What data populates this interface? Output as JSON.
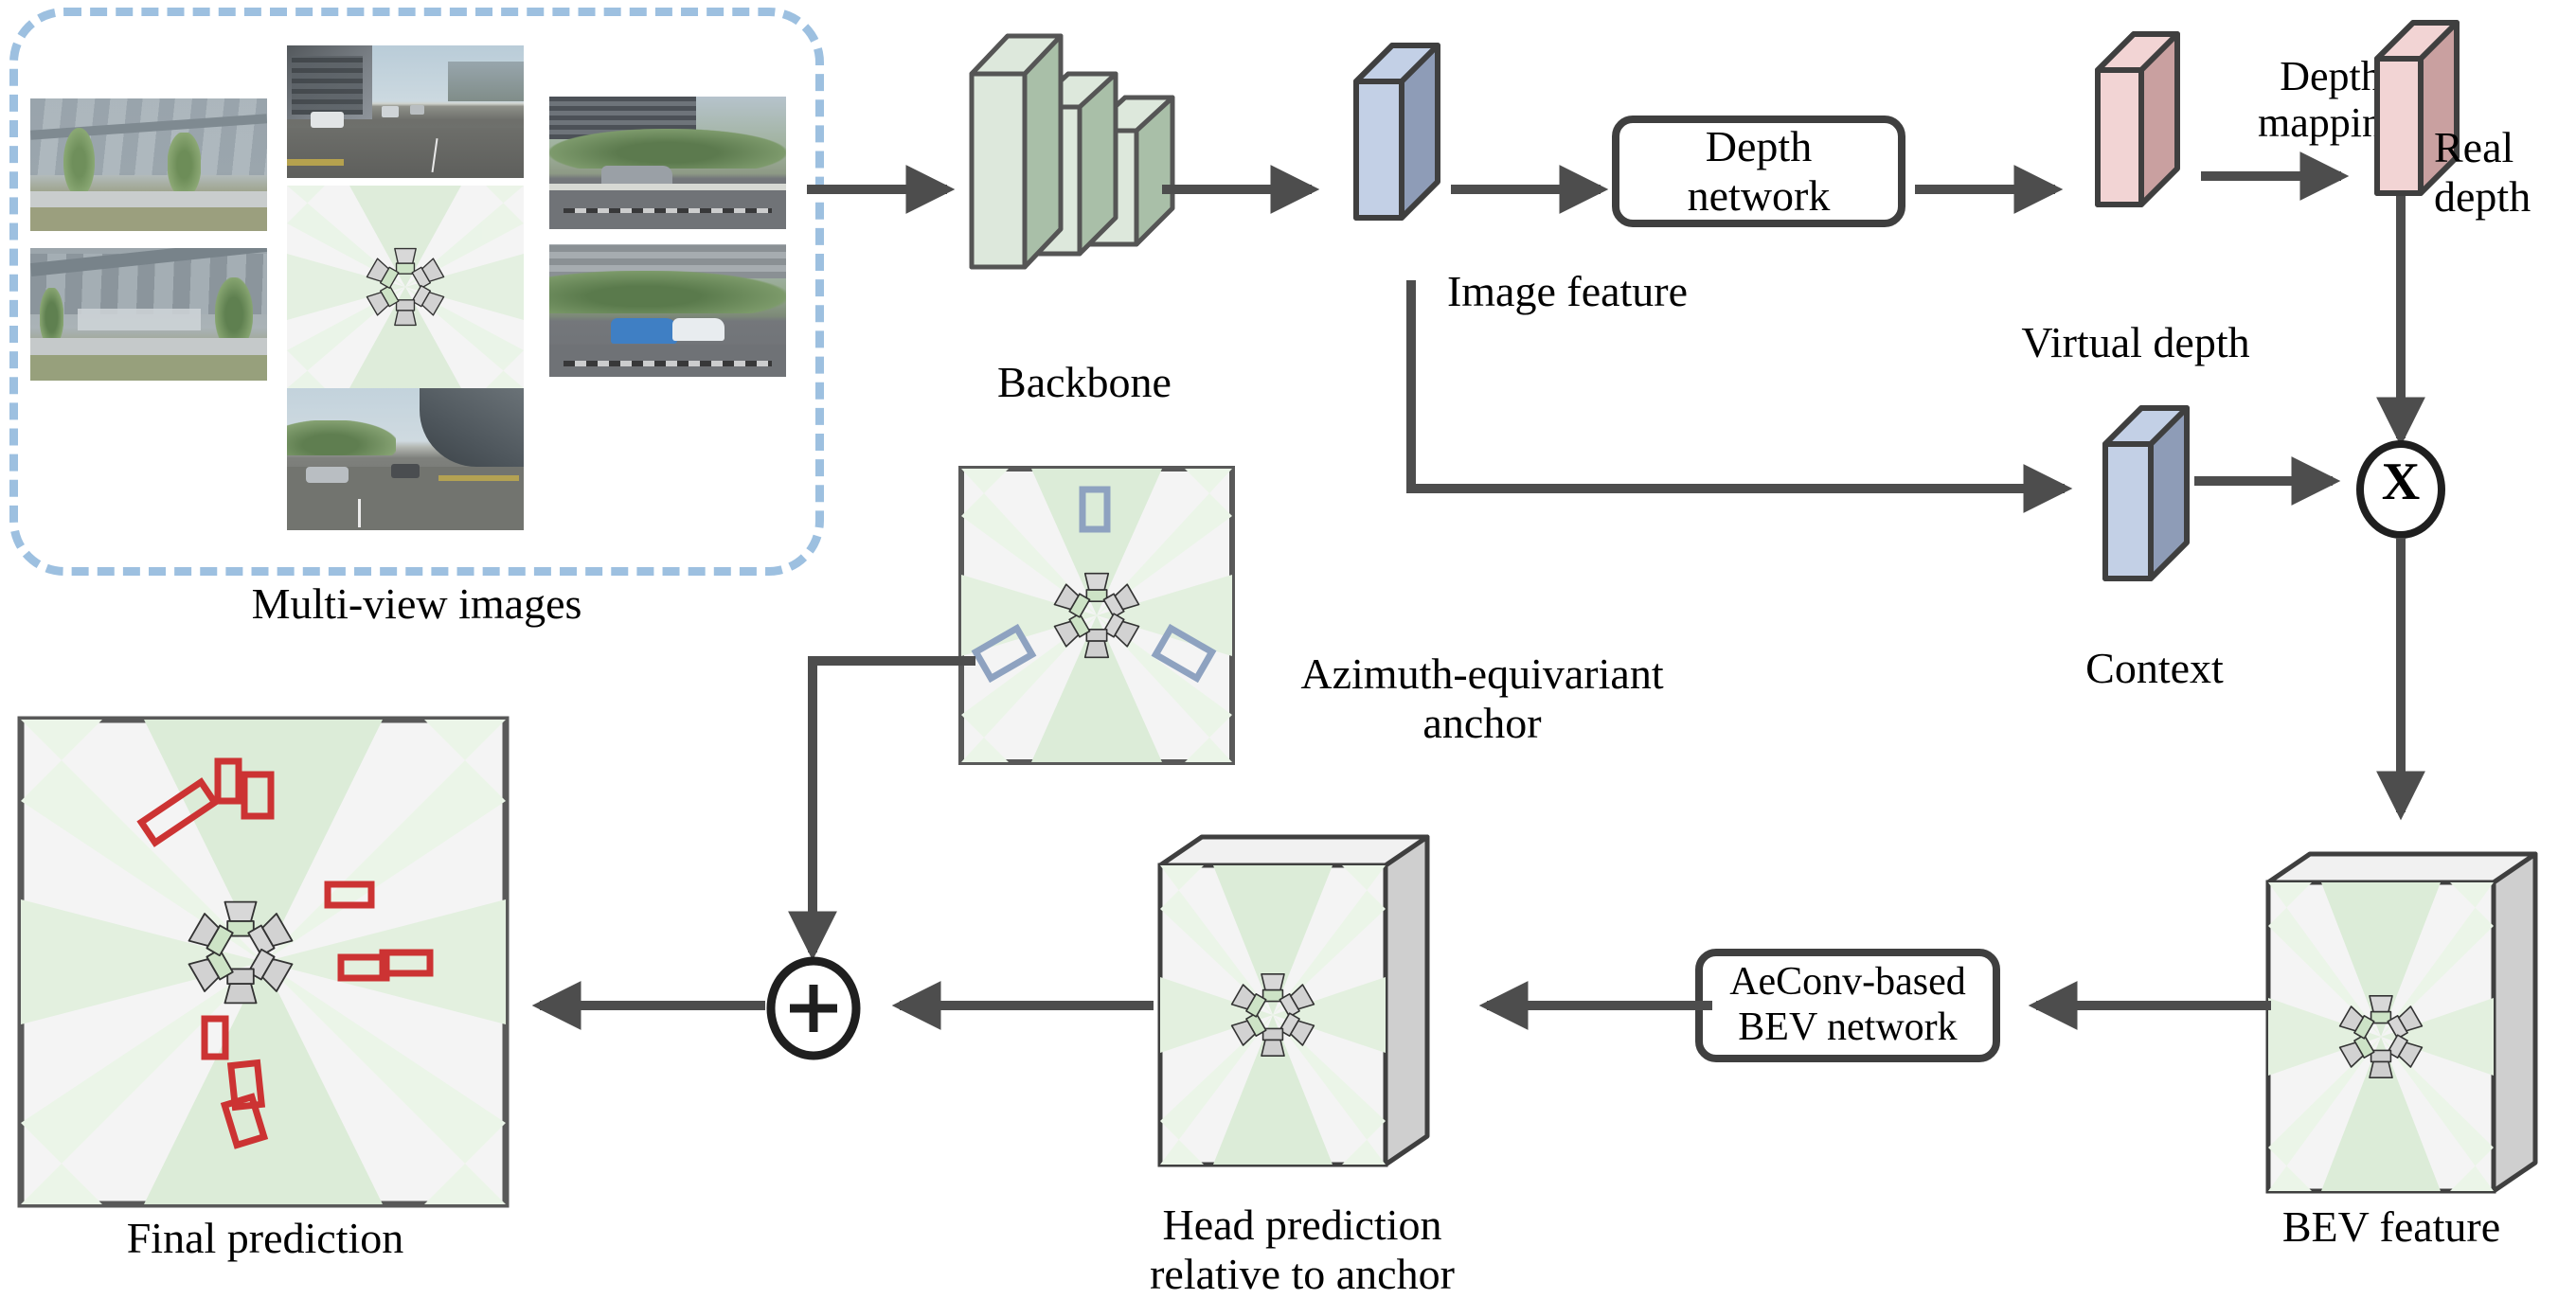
{
  "figure": {
    "type": "architecture-diagram",
    "title": "Azimuth-equivariant multi-view 3D detection pipeline",
    "background": "#ffffff"
  },
  "colors": {
    "arrow": "#4d4d4d",
    "outline": "#3f3f3f",
    "dashed_border": "#9dc0e0",
    "backbone_front": "#dde8dc",
    "backbone_side": "#a9bfa8",
    "feature_front": "#8e9cb7",
    "feature_side": "#c3d0e6",
    "depth_front": "#c9a0a0",
    "depth_side": "#f2d4d4",
    "bev_panel_bg": "#f4f4f4",
    "bev_sector": "#ddeedd",
    "bev_box_side": "#d6d6d6",
    "anchor_box": "#8ea2c0",
    "prediction_box": "#cc3333",
    "camera_body": "#cfcfcf",
    "camera_front_green": "#cde3c6"
  },
  "labels": {
    "multi_view_images": "Multi-view images",
    "backbone": "Backbone",
    "image_feature": "Image feature",
    "depth_network": "Depth\nnetwork",
    "virtual_depth": "Virtual depth",
    "depth_mapping": "Depth\nmapping",
    "real_depth": "Real\ndepth",
    "context": "Context",
    "multiply": "X",
    "bev_feature": "BEV feature",
    "aeconv_bev_network": "AeConv-based\nBEV network",
    "head_prediction": "Head prediction\nrelative to anchor",
    "azimuth_anchor": "Azimuth-equivariant\nanchor",
    "add": "+",
    "final_prediction": "Final prediction"
  },
  "nodes": [
    {
      "id": "multi-view-images",
      "label": "Multi-view images",
      "kind": "input-panel"
    },
    {
      "id": "backbone",
      "label": "Backbone",
      "kind": "conv-stack"
    },
    {
      "id": "image-feature",
      "label": "Image feature",
      "kind": "feature-slab"
    },
    {
      "id": "depth-network",
      "label": "Depth network",
      "kind": "rounded-module"
    },
    {
      "id": "virtual-depth",
      "label": "Virtual depth",
      "kind": "depth-slab"
    },
    {
      "id": "real-depth",
      "label": "Real depth",
      "kind": "depth-slab"
    },
    {
      "id": "context",
      "label": "Context",
      "kind": "feature-slab"
    },
    {
      "id": "multiply",
      "label": "X",
      "kind": "operator"
    },
    {
      "id": "bev-feature",
      "label": "BEV feature",
      "kind": "bev-volume"
    },
    {
      "id": "aeconv-bev-network",
      "label": "AeConv-based BEV network",
      "kind": "rounded-module"
    },
    {
      "id": "head-prediction",
      "label": "Head prediction relative to anchor",
      "kind": "bev-volume"
    },
    {
      "id": "azimuth-anchor",
      "label": "Azimuth-equivariant anchor",
      "kind": "bev-panel"
    },
    {
      "id": "add",
      "label": "+",
      "kind": "operator"
    },
    {
      "id": "final-prediction",
      "label": "Final prediction",
      "kind": "bev-panel"
    }
  ],
  "edges": [
    {
      "from": "multi-view-images",
      "to": "backbone"
    },
    {
      "from": "backbone",
      "to": "image-feature"
    },
    {
      "from": "image-feature",
      "to": "depth-network"
    },
    {
      "from": "depth-network",
      "to": "virtual-depth"
    },
    {
      "from": "virtual-depth",
      "to": "real-depth",
      "label": "Depth mapping"
    },
    {
      "from": "image-feature",
      "to": "context"
    },
    {
      "from": "context",
      "to": "multiply"
    },
    {
      "from": "real-depth",
      "to": "multiply"
    },
    {
      "from": "multiply",
      "to": "bev-feature"
    },
    {
      "from": "bev-feature",
      "to": "aeconv-bev-network"
    },
    {
      "from": "aeconv-bev-network",
      "to": "head-prediction"
    },
    {
      "from": "head-prediction",
      "to": "add"
    },
    {
      "from": "azimuth-anchor",
      "to": "add"
    },
    {
      "from": "add",
      "to": "final-prediction"
    }
  ],
  "multi_view": {
    "caption": "Multi-view images",
    "camera_count": 6,
    "views": [
      {
        "name": "front",
        "scene": "road ahead with buildings and cars"
      },
      {
        "name": "front-left",
        "scene": "glass building facade with trees"
      },
      {
        "name": "front-right",
        "scene": "car on roadside with trees"
      },
      {
        "name": "back-left",
        "scene": "building entrance with trees"
      },
      {
        "name": "back-right",
        "scene": "cars parked near building"
      },
      {
        "name": "back",
        "scene": "road behind with curved building"
      }
    ]
  },
  "chart_data": {
    "type": "diagram",
    "bev_panels": {
      "anchor": {
        "boxes": 3,
        "color": "#8ea2c0",
        "symmetry_deg": 120
      },
      "final_prediction": {
        "boxes": 9,
        "color": "#cc3333"
      }
    }
  }
}
